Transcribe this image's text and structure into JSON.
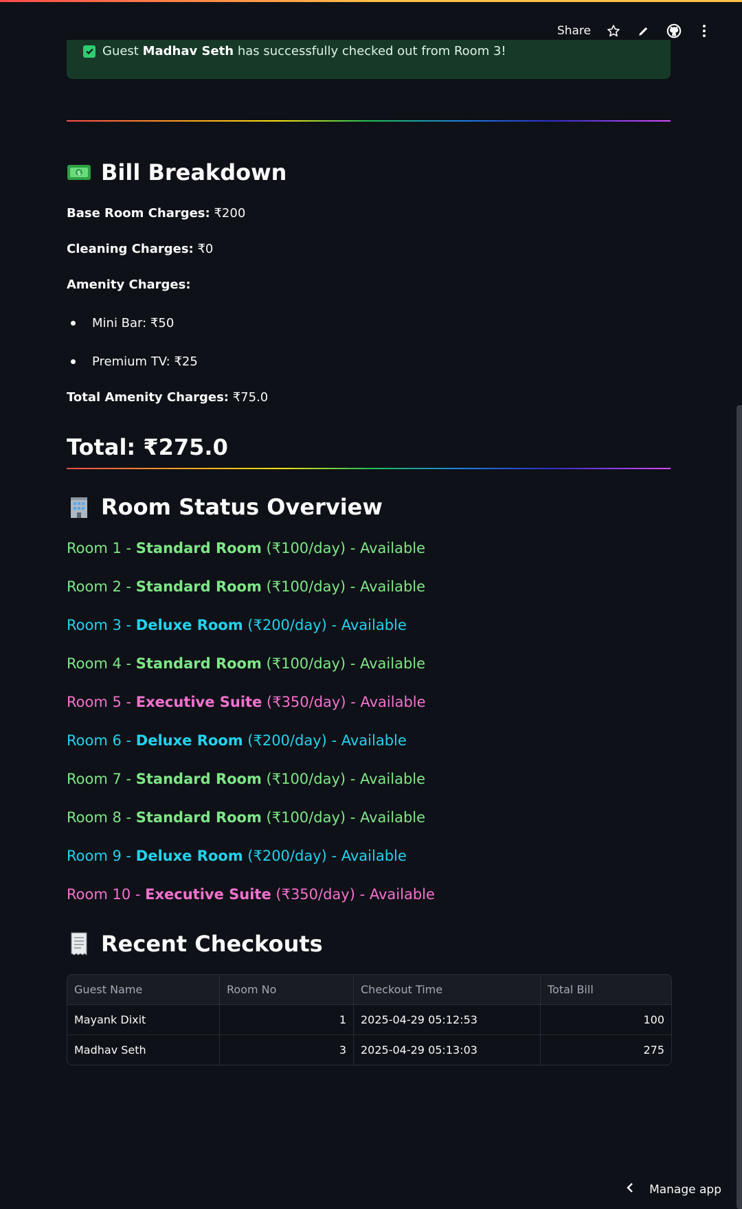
{
  "toolbar": {
    "share_label": "Share",
    "icons": [
      "star-icon",
      "pencil-icon",
      "github-icon",
      "more-vertical-icon"
    ]
  },
  "alert": {
    "prefix": "Guest ",
    "guest": "Madhav Seth",
    "suffix": " has successfully checked out from Room 3!"
  },
  "bill": {
    "title": "Bill Breakdown",
    "base_label": "Base Room Charges:",
    "base_value": " ₹200",
    "cleaning_label": "Cleaning Charges:",
    "cleaning_value": " ₹0",
    "amenity_label": "Amenity Charges:",
    "amenities": [
      "Mini Bar: ₹50",
      "Premium TV: ₹25"
    ],
    "total_amenity_label": "Total Amenity Charges:",
    "total_amenity_value": " ₹75.0",
    "total": "Total: ₹275.0"
  },
  "rooms": {
    "title": "Room Status Overview",
    "items": [
      {
        "prefix": "Room 1 - ",
        "type": "Standard Room",
        "suffix": " (₹100/day) - Available",
        "color": "#7ee787"
      },
      {
        "prefix": "Room 2 - ",
        "type": "Standard Room",
        "suffix": " (₹100/day) - Available",
        "color": "#7ee787"
      },
      {
        "prefix": "Room 3 - ",
        "type": "Deluxe Room",
        "suffix": " (₹200/day) - Available",
        "color": "#22d3ee"
      },
      {
        "prefix": "Room 4 - ",
        "type": "Standard Room",
        "suffix": " (₹100/day) - Available",
        "color": "#7ee787"
      },
      {
        "prefix": "Room 5 - ",
        "type": "Executive Suite",
        "suffix": " (₹350/day) - Available",
        "color": "#f472d0"
      },
      {
        "prefix": "Room 6 - ",
        "type": "Deluxe Room",
        "suffix": " (₹200/day) - Available",
        "color": "#22d3ee"
      },
      {
        "prefix": "Room 7 - ",
        "type": "Standard Room",
        "suffix": " (₹100/day) - Available",
        "color": "#7ee787"
      },
      {
        "prefix": "Room 8 - ",
        "type": "Standard Room",
        "suffix": " (₹100/day) - Available",
        "color": "#7ee787"
      },
      {
        "prefix": "Room 9 - ",
        "type": "Deluxe Room",
        "suffix": " (₹200/day) - Available",
        "color": "#22d3ee"
      },
      {
        "prefix": "Room 10 - ",
        "type": "Executive Suite",
        "suffix": " (₹350/day) - Available",
        "color": "#f472d0"
      }
    ]
  },
  "checkouts": {
    "title": "Recent Checkouts",
    "columns": [
      "Guest Name",
      "Room No",
      "Checkout Time",
      "Total Bill"
    ],
    "rows": [
      [
        "Mayank Dixit",
        "1",
        "2025-04-29 05:12:53",
        "100"
      ],
      [
        "Madhav Seth",
        "3",
        "2025-04-29 05:13:03",
        "275"
      ]
    ]
  },
  "footer": {
    "manage_label": "Manage app"
  }
}
